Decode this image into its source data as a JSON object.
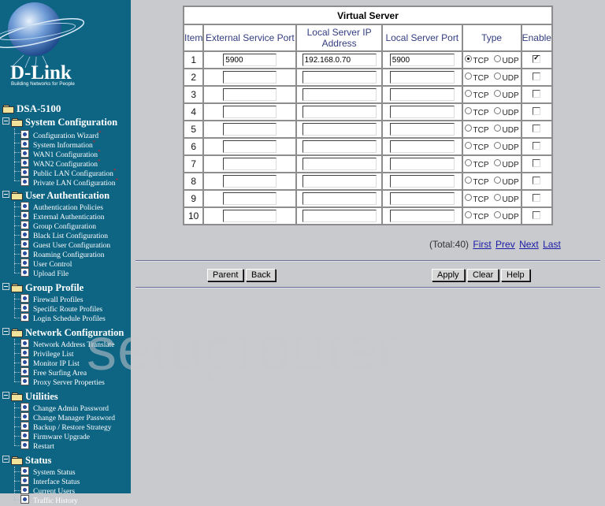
{
  "logo": {
    "brand": "D-Link",
    "tagline": "Building Networks for People"
  },
  "nav": {
    "root": "DSA-5100",
    "groups": [
      {
        "label": "System Configuration",
        "items": [
          {
            "label": "Configuration Wizard",
            "star": "*"
          },
          {
            "label": "System Information",
            "star": "*"
          },
          {
            "label": "WAN1 Configuration",
            "star": "*"
          },
          {
            "label": "WAN2 Configuration",
            "star": "*"
          },
          {
            "label": "Public LAN Configuration",
            "star": "*"
          },
          {
            "label": "Private LAN Configuration",
            "star": "*"
          }
        ]
      },
      {
        "label": "User Authentication",
        "items": [
          {
            "label": "Authentication Policies"
          },
          {
            "label": "External Authentication"
          },
          {
            "label": "Group Configuration"
          },
          {
            "label": "Black List Configuration"
          },
          {
            "label": "Guest User Configuration"
          },
          {
            "label": "Roaming Configuration"
          },
          {
            "label": "User Control"
          },
          {
            "label": "Upload File"
          }
        ]
      },
      {
        "label": "Group Profile",
        "items": [
          {
            "label": "Firewall Profiles"
          },
          {
            "label": "Specific Route Profiles"
          },
          {
            "label": "Login Schedule Profiles"
          }
        ]
      },
      {
        "label": "Network Configuration",
        "items": [
          {
            "label": "Network Address Translate"
          },
          {
            "label": "Privilege List"
          },
          {
            "label": "Monitor IP List"
          },
          {
            "label": "Free Surfing Area"
          },
          {
            "label": "Proxy Server Properties"
          }
        ]
      },
      {
        "label": "Utilities",
        "items": [
          {
            "label": "Change Admin Password"
          },
          {
            "label": "Change Manager Password"
          },
          {
            "label": "Backup / Restore Strategy"
          },
          {
            "label": "Firmware Upgrade"
          },
          {
            "label": "Restart"
          }
        ]
      },
      {
        "label": "Status",
        "items": [
          {
            "label": "System Status"
          },
          {
            "label": "Interface Status"
          },
          {
            "label": "Current Users"
          },
          {
            "label": "Traffic History"
          }
        ]
      }
    ]
  },
  "table": {
    "title": "Virtual Server",
    "headers": [
      "Item",
      "External Service Port",
      "Local Server IP Address",
      "Local Server Port",
      "Type",
      "Enable"
    ],
    "type_options": [
      "TCP",
      "UDP"
    ],
    "rows": [
      {
        "item": "1",
        "ext_port": "5900",
        "ip": "192.168.0.70",
        "local_port": "5900",
        "type": "TCP",
        "enabled": true
      },
      {
        "item": "2",
        "ext_port": "",
        "ip": "",
        "local_port": "",
        "type": "",
        "enabled": false
      },
      {
        "item": "3",
        "ext_port": "",
        "ip": "",
        "local_port": "",
        "type": "",
        "enabled": false
      },
      {
        "item": "4",
        "ext_port": "",
        "ip": "",
        "local_port": "",
        "type": "",
        "enabled": false
      },
      {
        "item": "5",
        "ext_port": "",
        "ip": "",
        "local_port": "",
        "type": "",
        "enabled": false
      },
      {
        "item": "6",
        "ext_port": "",
        "ip": "",
        "local_port": "",
        "type": "",
        "enabled": false
      },
      {
        "item": "7",
        "ext_port": "",
        "ip": "",
        "local_port": "",
        "type": "",
        "enabled": false
      },
      {
        "item": "8",
        "ext_port": "",
        "ip": "",
        "local_port": "",
        "type": "",
        "enabled": false
      },
      {
        "item": "9",
        "ext_port": "",
        "ip": "",
        "local_port": "",
        "type": "",
        "enabled": false
      },
      {
        "item": "10",
        "ext_port": "",
        "ip": "",
        "local_port": "",
        "type": "",
        "enabled": false
      }
    ]
  },
  "pager": {
    "total": "(Total:40)",
    "first": "First",
    "prev": "Prev",
    "next": "Next",
    "last": "Last"
  },
  "buttons": {
    "parent": "Parent",
    "back": "Back",
    "apply": "Apply",
    "clear": "Clear",
    "help": "Help"
  },
  "watermark": "setuprouter"
}
